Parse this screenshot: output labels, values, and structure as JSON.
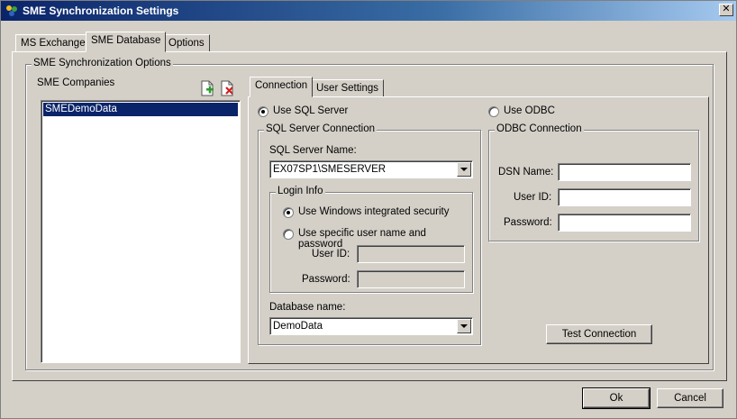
{
  "window": {
    "title": "SME Synchronization Settings"
  },
  "main_tabs": [
    {
      "label": "MS Exchange"
    },
    {
      "label": "SME Database"
    },
    {
      "label": "Options"
    }
  ],
  "sync_options": {
    "group_label": "SME Synchronization Options",
    "companies_label": "SME Companies",
    "companies": [
      "SMEDemoData"
    ],
    "add_icon": "add-document-icon",
    "delete_icon": "delete-document-icon"
  },
  "inner_tabs": [
    {
      "label": "Connection"
    },
    {
      "label": "User Settings"
    }
  ],
  "connection": {
    "use_sql_label": "Use SQL Server",
    "use_odbc_label": "Use ODBC",
    "sql_group_label": "SQL Server Connection",
    "sql_server_name_label": "SQL Server Name:",
    "sql_server_name_value": "EX07SP1\\SMESERVER",
    "login_info_label": "Login Info",
    "windows_auth_label": "Use Windows integrated security",
    "specific_auth_label": "Use specific user name and password",
    "user_id_label": "User ID:",
    "password_label": "Password:",
    "database_name_label": "Database name:",
    "database_name_value": "DemoData",
    "odbc_group_label": "ODBC Connection",
    "dsn_name_label": "DSN Name:",
    "odbc_user_id_label": "User ID:",
    "odbc_password_label": "Password:",
    "test_connection_label": "Test Connection"
  },
  "footer": {
    "ok_label": "Ok",
    "cancel_label": "Cancel"
  },
  "colors": {
    "titlebar": "#0a246a",
    "face": "#d4d0c8",
    "selection": "#0a246a"
  }
}
